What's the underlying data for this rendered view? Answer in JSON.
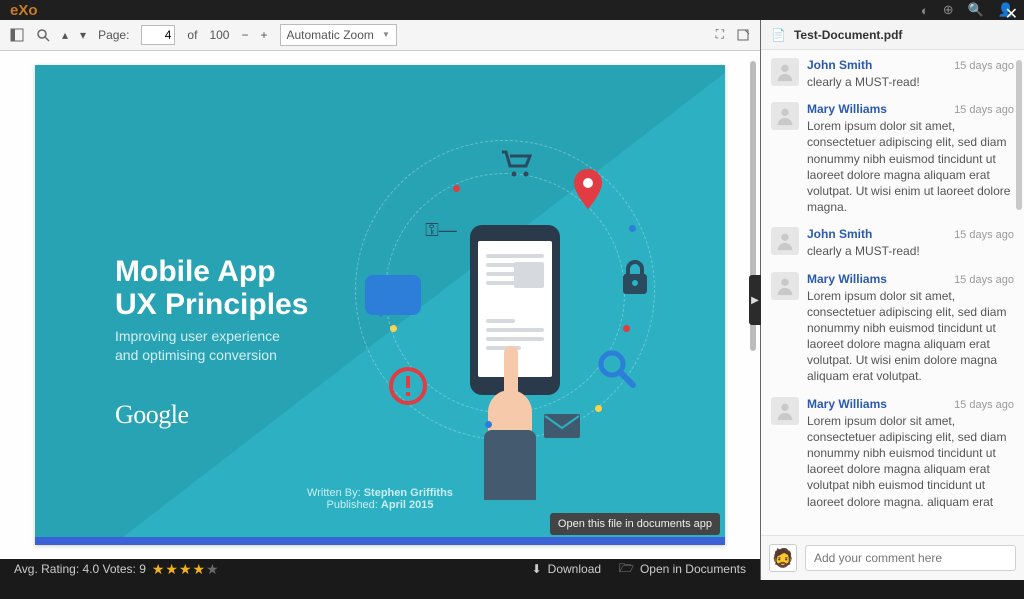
{
  "app": {
    "logo": "eXo"
  },
  "topbar_icons": [
    "notification-icon",
    "plus-icon",
    "search-icon",
    "user-icon"
  ],
  "toolbar": {
    "page_label": "Page:",
    "page_value": "4",
    "page_sep": "of",
    "page_total": "100",
    "zoom_label": "Automatic Zoom"
  },
  "slide": {
    "title_l1": "Mobile App",
    "title_l2": "UX Principles",
    "sub_l1": "Improving user experience",
    "sub_l2": "and optimising conversion",
    "brand": "Google",
    "foot_prefix": "Written By: ",
    "foot_author": "Stephen Griffiths",
    "foot_pub_prefix": "Published: ",
    "foot_date": "April 2015"
  },
  "tooltip": "Open this file in documents app",
  "footer": {
    "rating_label": "Avg. Rating: 4.0 Votes: 9",
    "download": "Download",
    "open_docs": "Open in Documents"
  },
  "panel": {
    "filename": "Test-Document.pdf",
    "input_placeholder": "Add your comment here",
    "comments": [
      {
        "author": "John Smith",
        "time": "15 days ago",
        "text": "clearly a MUST-read!"
      },
      {
        "author": "Mary Williams",
        "time": "15 days ago",
        "text": "Lorem ipsum dolor sit amet, consectetuer adipiscing elit, sed diam nonummy nibh euismod tincidunt ut laoreet dolore magna aliquam erat volutpat. Ut wisi enim ut laoreet dolore magna."
      },
      {
        "author": "John Smith",
        "time": "15 days ago",
        "text": "clearly a MUST-read!"
      },
      {
        "author": "Mary Williams",
        "time": "15 days ago",
        "text": "Lorem ipsum dolor sit amet, consectetuer adipiscing elit, sed diam nonummy nibh euismod tincidunt ut laoreet dolore magna aliquam erat volutpat. Ut wisi enim dolore magna aliquam erat volutpat."
      },
      {
        "author": "Mary Williams",
        "time": "15 days ago",
        "text": "Lorem ipsum dolor sit amet, consectetuer adipiscing elit, sed diam nonummy nibh euismod tincidunt ut laoreet dolore magna aliquam erat volutpat nibh euismod tincidunt ut laoreet dolore magna. aliquam erat"
      }
    ]
  }
}
